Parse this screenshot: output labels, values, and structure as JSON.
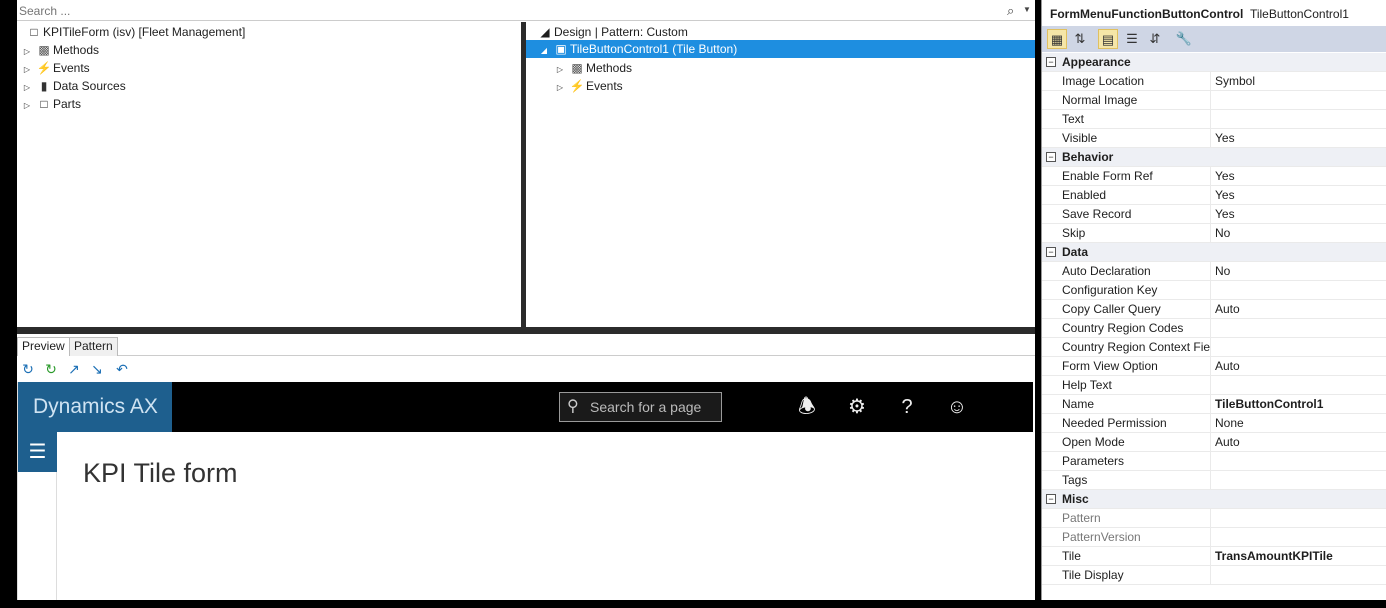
{
  "search": {
    "placeholder": "Search ..."
  },
  "tree_left": {
    "root": "KPITileForm (isv) [Fleet Management]",
    "items": [
      "Methods",
      "Events",
      "Data Sources",
      "Parts"
    ]
  },
  "tree_right": {
    "root": "Design | Pattern: Custom",
    "selected": "TileButtonControl1 (Tile Button)",
    "items": [
      "Methods",
      "Events"
    ]
  },
  "tabs": [
    "Preview",
    "Pattern"
  ],
  "preview": {
    "brand": "Dynamics AX",
    "search_placeholder": "Search for a page",
    "page_title": "KPI Tile form"
  },
  "properties": {
    "type": "FormMenuFunctionButtonControl",
    "name": "TileButtonControl1",
    "categories": [
      {
        "name": "Appearance",
        "rows": [
          {
            "n": "Image Location",
            "v": "Symbol"
          },
          {
            "n": "Normal Image",
            "v": ""
          },
          {
            "n": "Text",
            "v": ""
          },
          {
            "n": "Visible",
            "v": "Yes"
          }
        ]
      },
      {
        "name": "Behavior",
        "rows": [
          {
            "n": "Enable Form Ref",
            "v": "Yes"
          },
          {
            "n": "Enabled",
            "v": "Yes"
          },
          {
            "n": "Save Record",
            "v": "Yes"
          },
          {
            "n": "Skip",
            "v": "No"
          }
        ]
      },
      {
        "name": "Data",
        "rows": [
          {
            "n": "Auto Declaration",
            "v": "No"
          },
          {
            "n": "Configuration Key",
            "v": ""
          },
          {
            "n": "Copy Caller Query",
            "v": "Auto"
          },
          {
            "n": "Country Region Codes",
            "v": ""
          },
          {
            "n": "Country Region Context Fiel",
            "v": ""
          },
          {
            "n": "Form View Option",
            "v": "Auto"
          },
          {
            "n": "Help Text",
            "v": ""
          },
          {
            "n": "Name",
            "v": "TileButtonControl1"
          },
          {
            "n": "Needed Permission",
            "v": "None"
          },
          {
            "n": "Open Mode",
            "v": "Auto"
          },
          {
            "n": "Parameters",
            "v": ""
          },
          {
            "n": "Tags",
            "v": ""
          }
        ]
      },
      {
        "name": "Misc",
        "rows": [
          {
            "n": "Pattern",
            "v": ""
          },
          {
            "n": "PatternVersion",
            "v": ""
          },
          {
            "n": "Tile",
            "v": "TransAmountKPITile"
          },
          {
            "n": "Tile Display",
            "v": ""
          }
        ]
      }
    ]
  }
}
